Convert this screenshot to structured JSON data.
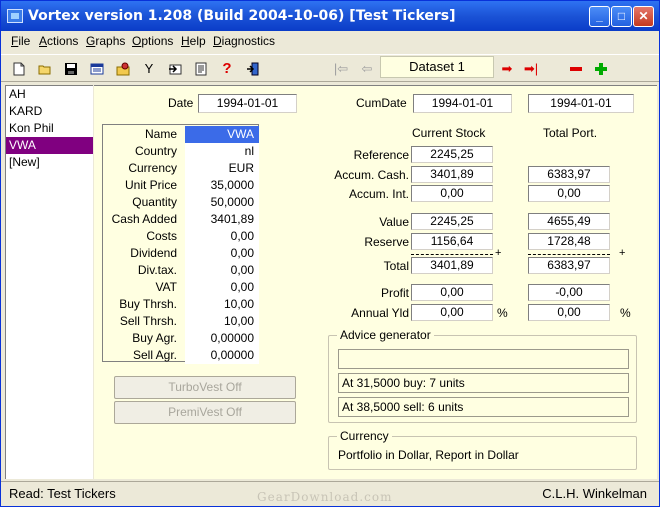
{
  "window": {
    "title": "Vortex version 1.208 (Build 2004-10-06)  [Test Tickers]"
  },
  "menu": [
    {
      "key": "F",
      "rest": "ile"
    },
    {
      "key": "A",
      "rest": "ctions"
    },
    {
      "key": "G",
      "rest": "raphs"
    },
    {
      "key": "O",
      "rest": "ptions"
    },
    {
      "key": "H",
      "rest": "elp"
    },
    {
      "key": "D",
      "rest": "iagnostics"
    }
  ],
  "toolbar": {
    "dataset": "Dataset 1"
  },
  "tickers": [
    "AH",
    "KARD",
    "Kon Phil",
    "VWA",
    "[New]"
  ],
  "selected_ticker": "VWA",
  "dates": {
    "date_label": "Date",
    "date_value": "1994-01-01",
    "cumdate_label": "CumDate",
    "cumdate_value": "1994-01-01",
    "total_date": "1994-01-01"
  },
  "stock_fields": [
    {
      "label": "Name",
      "value": "VWA"
    },
    {
      "label": "Country",
      "value": "nl"
    },
    {
      "label": "Currency",
      "value": "EUR"
    },
    {
      "label": "Unit Price",
      "value": "35,0000"
    },
    {
      "label": "Quantity",
      "value": "50,0000"
    },
    {
      "label": "Cash Added",
      "value": "3401,89"
    },
    {
      "label": "Costs",
      "value": "0,00"
    },
    {
      "label": "Dividend",
      "value": "0,00"
    },
    {
      "label": "Div.tax.",
      "value": "0,00"
    },
    {
      "label": "VAT",
      "value": "0,00"
    },
    {
      "label": "Buy Thrsh.",
      "value": "10,00"
    },
    {
      "label": "Sell Thrsh.",
      "value": "10,00"
    },
    {
      "label": "Buy Agr.",
      "value": "0,00000"
    },
    {
      "label": "Sell Agr.",
      "value": "0,00000"
    }
  ],
  "buttons": {
    "turbovest": "TurboVest Off",
    "premivest": "PremiVest Off"
  },
  "headers": {
    "current_stock": "Current Stock",
    "total_port": "Total Port."
  },
  "metrics": {
    "reference": {
      "label": "Reference",
      "current": "2245,25"
    },
    "accum_cash": {
      "label": "Accum. Cash.",
      "current": "3401,89",
      "total": "6383,97"
    },
    "accum_int": {
      "label": "Accum. Int.",
      "current": "0,00",
      "total": "0,00"
    },
    "value": {
      "label": "Value",
      "current": "2245,25",
      "total": "4655,49"
    },
    "reserve": {
      "label": "Reserve",
      "current": "1156,64",
      "total": "1728,48"
    },
    "total": {
      "label": "Total",
      "current": "3401,89",
      "total": "6383,97"
    },
    "profit": {
      "label": "Profit",
      "current": "0,00",
      "total": "-0,00"
    },
    "annual_yld": {
      "label": "Annual Yld",
      "current": "0,00",
      "total": "0,00"
    },
    "plus_sign": "+",
    "percent_sign": "%"
  },
  "advice": {
    "title": "Advice generator",
    "line1": "",
    "line2": "At 31,5000 buy: 7 units",
    "line3": "At 38,5000 sell: 6 units"
  },
  "currency": {
    "title": "Currency",
    "text": "Portfolio in Dollar, Report in Dollar"
  },
  "status": {
    "left": "Read: Test Tickers",
    "right": "C.L.H. Winkelman"
  },
  "watermark": "GearDownload.com",
  "colors": {
    "selected_ticker_bg": "#800080",
    "panel_bg": "#FFFFE1",
    "name_highlight": "#3B6BE8"
  }
}
